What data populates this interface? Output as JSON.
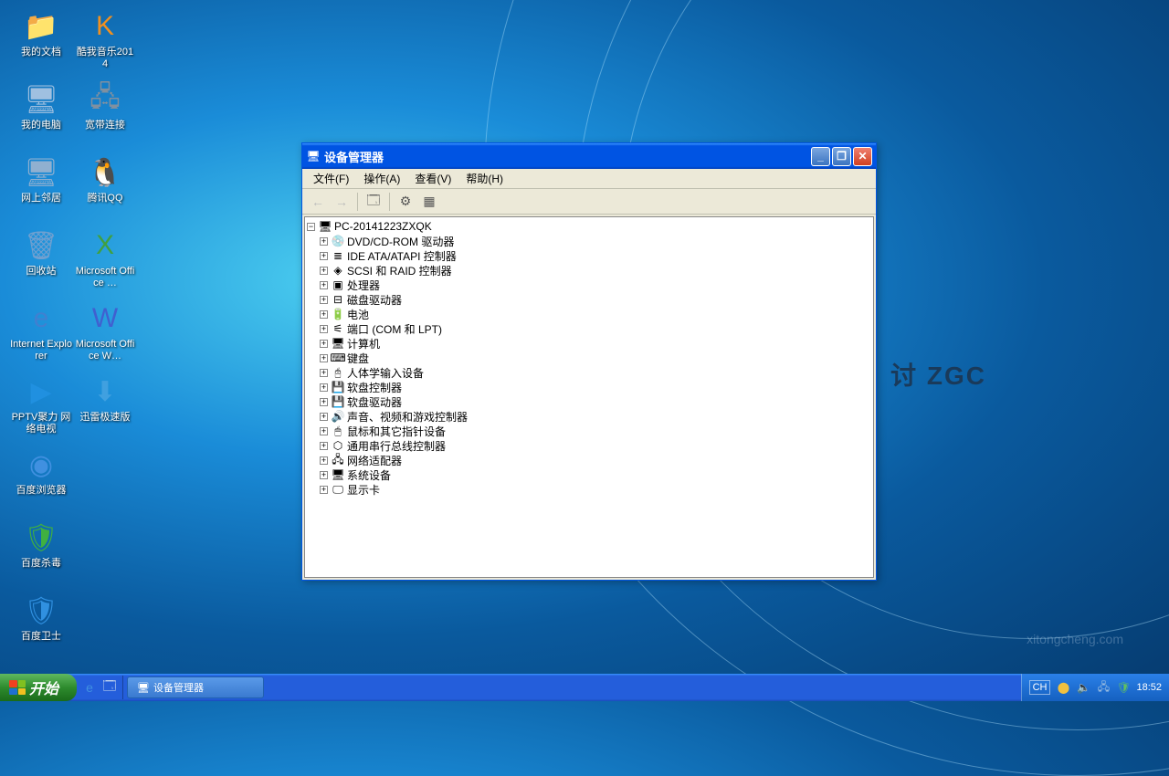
{
  "desktop": {
    "icons": [
      {
        "label": "我的文档",
        "glyph": "📁",
        "color": "#f0d060"
      },
      {
        "label": "我的电脑",
        "glyph": "🖥",
        "color": "#a0c0e0"
      },
      {
        "label": "网上邻居",
        "glyph": "🖥",
        "color": "#90b0d0"
      },
      {
        "label": "回收站",
        "glyph": "🗑",
        "color": "#70a0d0"
      },
      {
        "label": "Internet Explorer",
        "glyph": "e",
        "color": "#4080d0"
      },
      {
        "label": "PPTV聚力 网络电视",
        "glyph": "▶",
        "color": "#2090e0"
      },
      {
        "label": "百度浏览器",
        "glyph": "◉",
        "color": "#4090e0"
      },
      {
        "label": "百度杀毒",
        "glyph": "🛡",
        "color": "#40b040"
      },
      {
        "label": "百度卫士",
        "glyph": "🛡",
        "color": "#3090e0"
      },
      {
        "label": "酷我音乐2014",
        "glyph": "K",
        "color": "#f09020"
      },
      {
        "label": "宽带连接",
        "glyph": "🖧",
        "color": "#8090a0"
      },
      {
        "label": "腾讯QQ",
        "glyph": "🐧",
        "color": "#000"
      },
      {
        "label": "Microsoft Office …",
        "glyph": "X",
        "color": "#40a040"
      },
      {
        "label": "Microsoft Office W…",
        "glyph": "W",
        "color": "#4060d0"
      },
      {
        "label": "迅雷极速版",
        "glyph": "⬇",
        "color": "#40a0e0"
      }
    ],
    "watermark_right": "讨  ZGC",
    "watermark_url": "xitongcheng.com"
  },
  "window": {
    "title": "设备管理器",
    "menus": [
      {
        "label": "文件",
        "accel": "F"
      },
      {
        "label": "操作",
        "accel": "A"
      },
      {
        "label": "查看",
        "accel": "V"
      },
      {
        "label": "帮助",
        "accel": "H"
      }
    ],
    "root_node": "PC-20141223ZXQK",
    "devices": [
      {
        "label": "DVD/CD-ROM 驱动器",
        "icon": "💿"
      },
      {
        "label": "IDE ATA/ATAPI 控制器",
        "icon": "≣"
      },
      {
        "label": "SCSI 和 RAID 控制器",
        "icon": "◈"
      },
      {
        "label": "处理器",
        "icon": "▣"
      },
      {
        "label": "磁盘驱动器",
        "icon": "⊟"
      },
      {
        "label": "电池",
        "icon": "🔋"
      },
      {
        "label": "端口 (COM 和 LPT)",
        "icon": "⚟"
      },
      {
        "label": "计算机",
        "icon": "🖥"
      },
      {
        "label": "键盘",
        "icon": "⌨"
      },
      {
        "label": "人体学输入设备",
        "icon": "🖰"
      },
      {
        "label": "软盘控制器",
        "icon": "💾"
      },
      {
        "label": "软盘驱动器",
        "icon": "💾"
      },
      {
        "label": "声音、视频和游戏控制器",
        "icon": "🔊"
      },
      {
        "label": "鼠标和其它指针设备",
        "icon": "🖱"
      },
      {
        "label": "通用串行总线控制器",
        "icon": "⬡"
      },
      {
        "label": "网络适配器",
        "icon": "🖧"
      },
      {
        "label": "系统设备",
        "icon": "🖥"
      },
      {
        "label": "显示卡",
        "icon": "🖵"
      }
    ]
  },
  "taskbar": {
    "start": "开始",
    "task_button": "设备管理器",
    "language": "CH",
    "clock": "18:52"
  }
}
